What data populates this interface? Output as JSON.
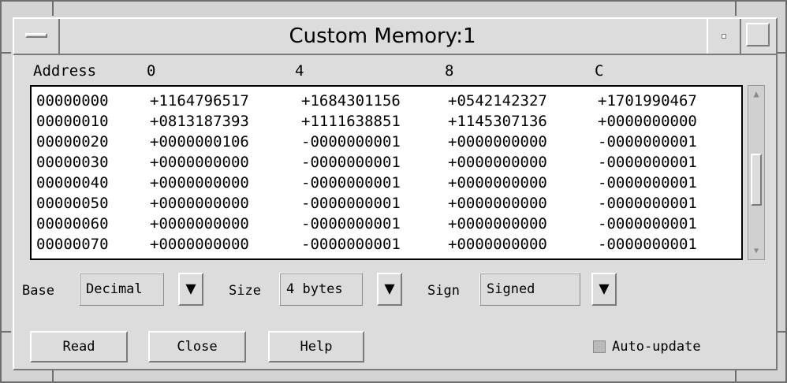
{
  "window": {
    "title": "Custom Memory:1"
  },
  "header": {
    "address": "Address",
    "cols": [
      "0",
      "4",
      "8",
      "C"
    ]
  },
  "rows": [
    {
      "addr": "00000000",
      "v": [
        "+1164796517",
        "+1684301156",
        "+0542142327",
        "+1701990467"
      ]
    },
    {
      "addr": "00000010",
      "v": [
        "+0813187393",
        "+1111638851",
        "+1145307136",
        "+0000000000"
      ]
    },
    {
      "addr": "00000020",
      "v": [
        "+0000000106",
        "-0000000001",
        "+0000000000",
        "-0000000001"
      ]
    },
    {
      "addr": "00000030",
      "v": [
        "+0000000000",
        "-0000000001",
        "+0000000000",
        "-0000000001"
      ]
    },
    {
      "addr": "00000040",
      "v": [
        "+0000000000",
        "-0000000001",
        "+0000000000",
        "-0000000001"
      ]
    },
    {
      "addr": "00000050",
      "v": [
        "+0000000000",
        "-0000000001",
        "+0000000000",
        "-0000000001"
      ]
    },
    {
      "addr": "00000060",
      "v": [
        "+0000000000",
        "-0000000001",
        "+0000000000",
        "-0000000001"
      ]
    },
    {
      "addr": "00000070",
      "v": [
        "+0000000000",
        "-0000000001",
        "+0000000000",
        "-0000000001"
      ]
    }
  ],
  "options": {
    "base_label": "Base",
    "base_value": "Decimal",
    "size_label": "Size",
    "size_value": "4 bytes",
    "sign_label": "Sign",
    "sign_value": "Signed"
  },
  "buttons": {
    "read": "Read",
    "close": "Close",
    "help": "Help"
  },
  "auto_update": {
    "label": "Auto-update",
    "checked": false
  },
  "icons": {
    "dropdown": "▼",
    "scroll_up": "▲",
    "scroll_down": "▼"
  }
}
